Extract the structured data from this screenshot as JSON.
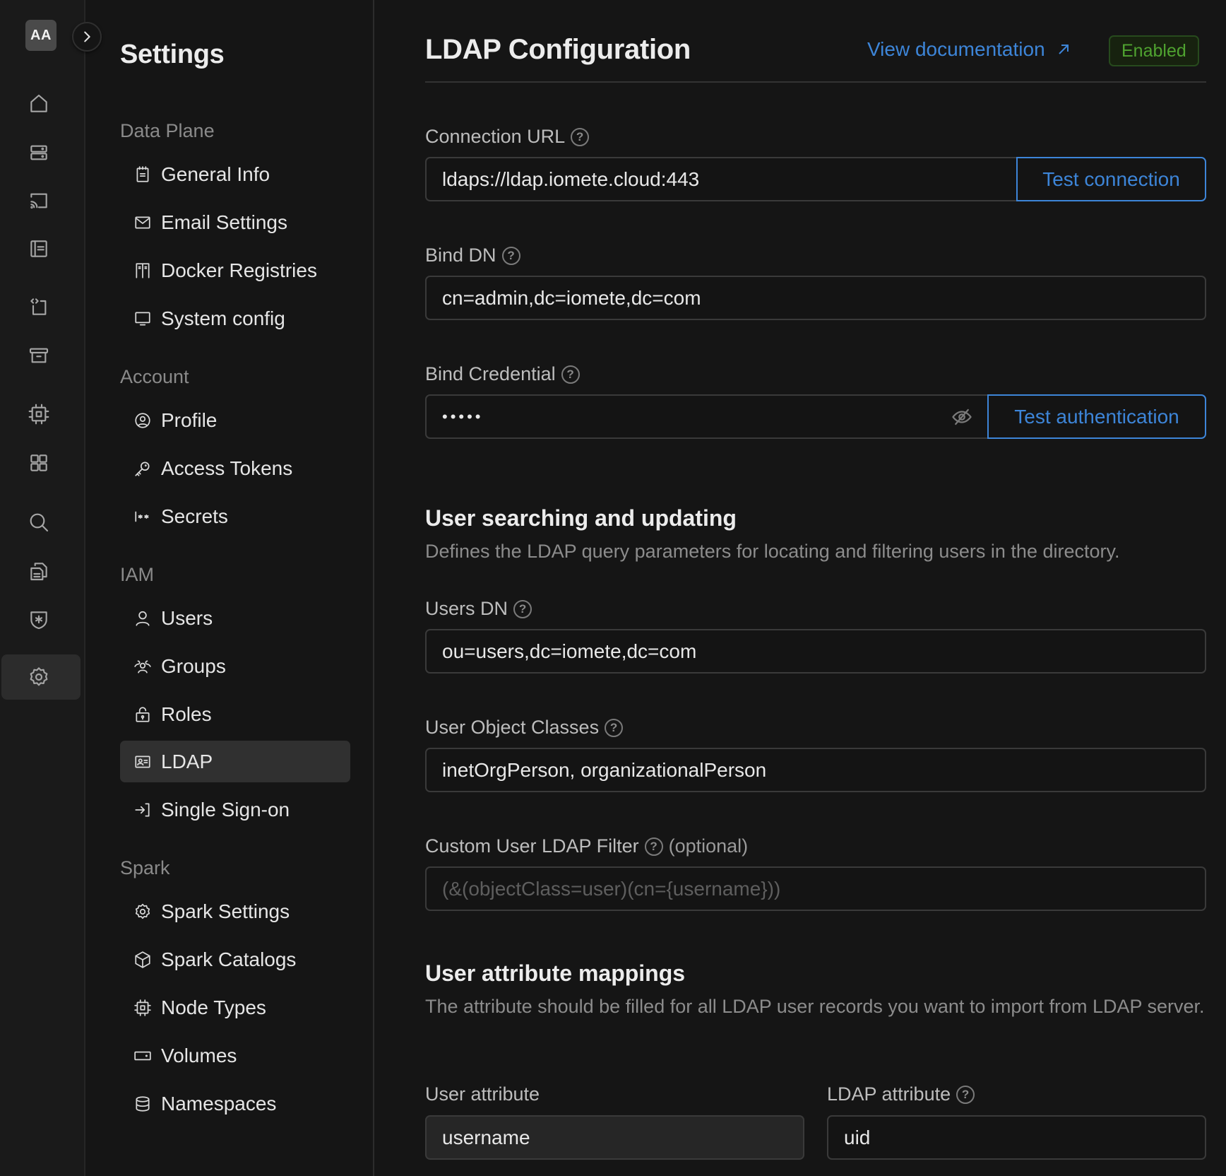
{
  "rail": {
    "avatar_initials": "AA",
    "expand_icon": "chevron-right-icon",
    "items": [
      {
        "icon": "home-icon"
      },
      {
        "icon": "server-icon"
      },
      {
        "icon": "cast-icon"
      },
      {
        "icon": "notebook-icon"
      },
      {
        "icon": "code-file-icon"
      },
      {
        "icon": "archive-icon"
      },
      {
        "icon": "cpu-icon"
      },
      {
        "icon": "grid-icon"
      },
      {
        "icon": "search-icon"
      },
      {
        "icon": "documents-icon"
      },
      {
        "icon": "shield-icon"
      },
      {
        "icon": "gear-icon",
        "active": true
      }
    ]
  },
  "sidebar": {
    "title": "Settings",
    "groups": [
      {
        "label": "Data Plane",
        "items": [
          {
            "label": "General Info",
            "icon": "clipboard-icon"
          },
          {
            "label": "Email Settings",
            "icon": "mail-icon"
          },
          {
            "label": "Docker Registries",
            "icon": "lockers-icon"
          },
          {
            "label": "System config",
            "icon": "monitor-icon"
          }
        ]
      },
      {
        "label": "Account",
        "items": [
          {
            "label": "Profile",
            "icon": "user-circle-icon"
          },
          {
            "label": "Access Tokens",
            "icon": "key-icon"
          },
          {
            "label": "Secrets",
            "icon": "secret-icon"
          }
        ]
      },
      {
        "label": "IAM",
        "items": [
          {
            "label": "Users",
            "icon": "user-icon"
          },
          {
            "label": "Groups",
            "icon": "users-icon"
          },
          {
            "label": "Roles",
            "icon": "lock-open-icon"
          },
          {
            "label": "LDAP",
            "icon": "id-card-icon",
            "active": true
          },
          {
            "label": "Single Sign-on",
            "icon": "login-icon"
          }
        ]
      },
      {
        "label": "Spark",
        "items": [
          {
            "label": "Spark Settings",
            "icon": "gear-icon"
          },
          {
            "label": "Spark Catalogs",
            "icon": "cube-icon"
          },
          {
            "label": "Node Types",
            "icon": "cpu-icon"
          },
          {
            "label": "Volumes",
            "icon": "drive-icon"
          },
          {
            "label": "Namespaces",
            "icon": "database-icon"
          }
        ]
      }
    ]
  },
  "main": {
    "title": "LDAP Configuration",
    "doc_link": "View documentation",
    "status": "Enabled",
    "colors": {
      "accent": "#3d85d8",
      "success": "#4fa330"
    },
    "connection": {
      "url_label": "Connection URL",
      "url_value": "ldaps://ldap.iomete.cloud:443",
      "test_connection": "Test connection",
      "bind_dn_label": "Bind DN",
      "bind_dn_value": "cn=admin,dc=iomete,dc=com",
      "bind_credential_label": "Bind Credential",
      "bind_credential_value": "•••••",
      "test_authentication": "Test authentication"
    },
    "user_search": {
      "title": "User searching and updating",
      "description": "Defines the LDAP query parameters for locating and filtering users in the directory.",
      "users_dn_label": "Users DN",
      "users_dn_value": "ou=users,dc=iomete,dc=com",
      "object_classes_label": "User Object Classes",
      "object_classes_value": "inetOrgPerson, organizationalPerson",
      "filter_label": "Custom User LDAP Filter",
      "filter_optional": "(optional)",
      "filter_placeholder": "(&(objectClass=user)(cn={username}))"
    },
    "attribute_mappings": {
      "title": "User attribute mappings",
      "description": "The attribute should be filled for all LDAP user records you want to import from LDAP server.",
      "user_attribute_label": "User attribute",
      "ldap_attribute_label": "LDAP attribute",
      "rows": [
        {
          "user_attribute": "username",
          "ldap_attribute": "uid"
        }
      ]
    }
  }
}
